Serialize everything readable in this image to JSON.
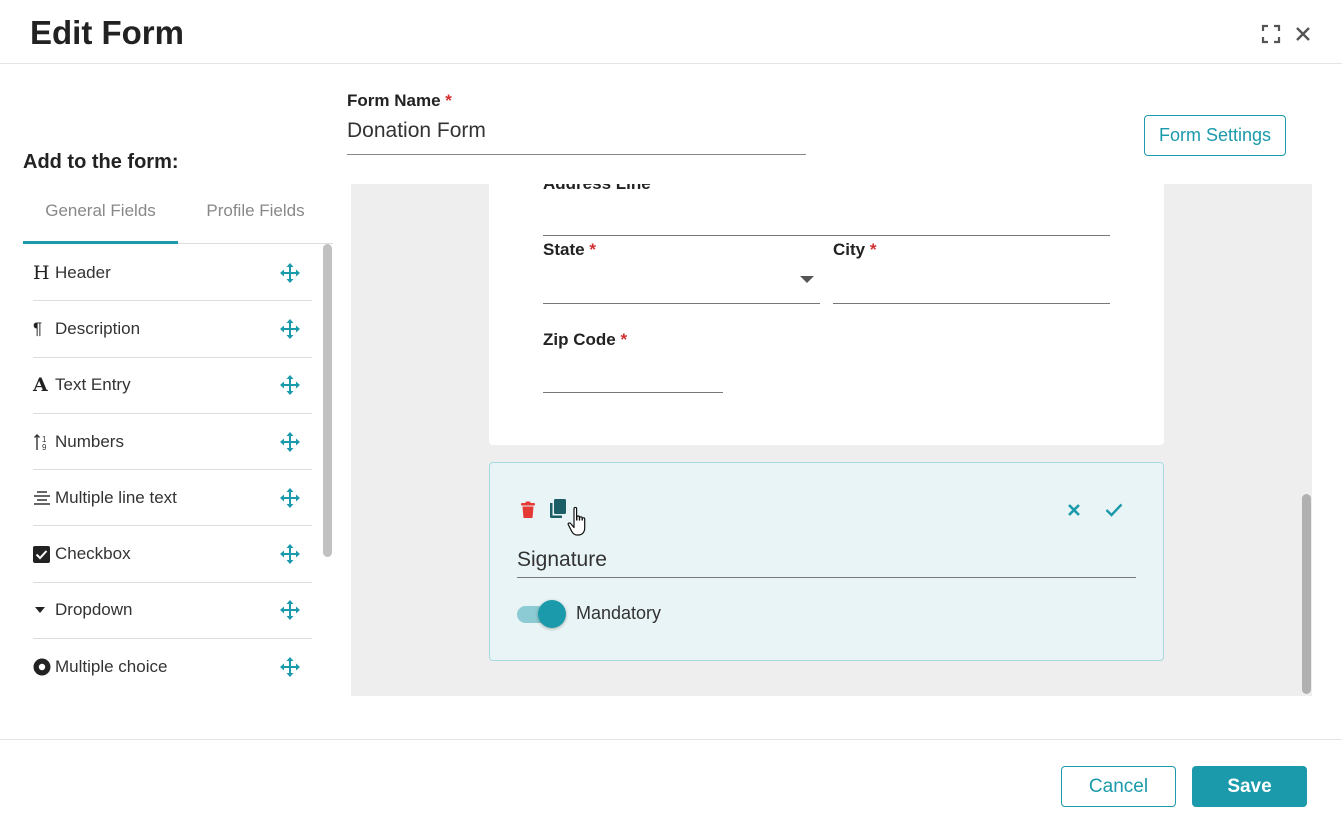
{
  "header": {
    "title": "Edit Form",
    "expand_icon": "expand-icon",
    "close_icon": "close-icon"
  },
  "sidebar": {
    "title": "Add to the form:",
    "tabs": [
      {
        "label": "General Fields",
        "active": true
      },
      {
        "label": "Profile Fields",
        "active": false
      }
    ],
    "items": [
      {
        "label": "Header",
        "icon": "header-icon",
        "glyph": "H"
      },
      {
        "label": "Description",
        "icon": "paragraph-icon",
        "glyph": "¶"
      },
      {
        "label": "Text Entry",
        "icon": "text-icon",
        "glyph": "A"
      },
      {
        "label": "Numbers",
        "icon": "numbers-icon",
        "glyph": "↑"
      },
      {
        "label": "Multiple line text",
        "icon": "multiline-icon",
        "glyph": "≡"
      },
      {
        "label": "Checkbox",
        "icon": "checkbox-icon",
        "glyph": ""
      },
      {
        "label": "Dropdown",
        "icon": "dropdown-icon",
        "glyph": ""
      },
      {
        "label": "Multiple choice",
        "icon": "radio-icon",
        "glyph": ""
      }
    ]
  },
  "form": {
    "name_label": "Form Name",
    "required_mark": "*",
    "name_value": "Donation Form",
    "settings_button": "Form Settings"
  },
  "canvas": {
    "address_label": "Address Line",
    "state_label": "State",
    "city_label": "City",
    "zip_label": "Zip Code",
    "signature": {
      "value": "Signature",
      "mandatory_label": "Mandatory",
      "mandatory_on": true
    }
  },
  "footer": {
    "cancel": "Cancel",
    "save": "Save"
  },
  "colors": {
    "accent": "#1a9aab",
    "required": "#d32f2f",
    "delete": "#e53935",
    "copy": "#1b5e66"
  }
}
